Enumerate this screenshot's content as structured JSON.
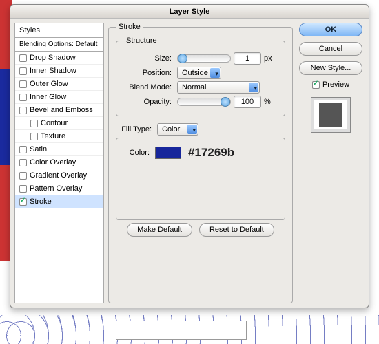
{
  "window": {
    "title": "Layer Style"
  },
  "sidebar": {
    "header": "Styles",
    "blending": "Blending Options: Default",
    "items": [
      {
        "label": "Drop Shadow",
        "checked": false,
        "indent": false
      },
      {
        "label": "Inner Shadow",
        "checked": false,
        "indent": false
      },
      {
        "label": "Outer Glow",
        "checked": false,
        "indent": false
      },
      {
        "label": "Inner Glow",
        "checked": false,
        "indent": false
      },
      {
        "label": "Bevel and Emboss",
        "checked": false,
        "indent": false
      },
      {
        "label": "Contour",
        "checked": false,
        "indent": true
      },
      {
        "label": "Texture",
        "checked": false,
        "indent": true
      },
      {
        "label": "Satin",
        "checked": false,
        "indent": false
      },
      {
        "label": "Color Overlay",
        "checked": false,
        "indent": false
      },
      {
        "label": "Gradient Overlay",
        "checked": false,
        "indent": false
      },
      {
        "label": "Pattern Overlay",
        "checked": false,
        "indent": false
      },
      {
        "label": "Stroke",
        "checked": true,
        "indent": false,
        "selected": true
      }
    ]
  },
  "stroke": {
    "panel_title": "Stroke",
    "structure_title": "Structure",
    "size_label": "Size:",
    "size_value": "1",
    "size_unit": "px",
    "position_label": "Position:",
    "position_value": "Outside",
    "blend_label": "Blend Mode:",
    "blend_value": "Normal",
    "opacity_label": "Opacity:",
    "opacity_value": "100",
    "opacity_unit": "%",
    "filltype_label": "Fill Type:",
    "filltype_value": "Color",
    "color_label": "Color:",
    "color_hex": "#17269b",
    "make_default": "Make Default",
    "reset_default": "Reset to Default"
  },
  "right": {
    "ok": "OK",
    "cancel": "Cancel",
    "new_style": "New Style...",
    "preview": "Preview",
    "preview_color": "#555"
  }
}
